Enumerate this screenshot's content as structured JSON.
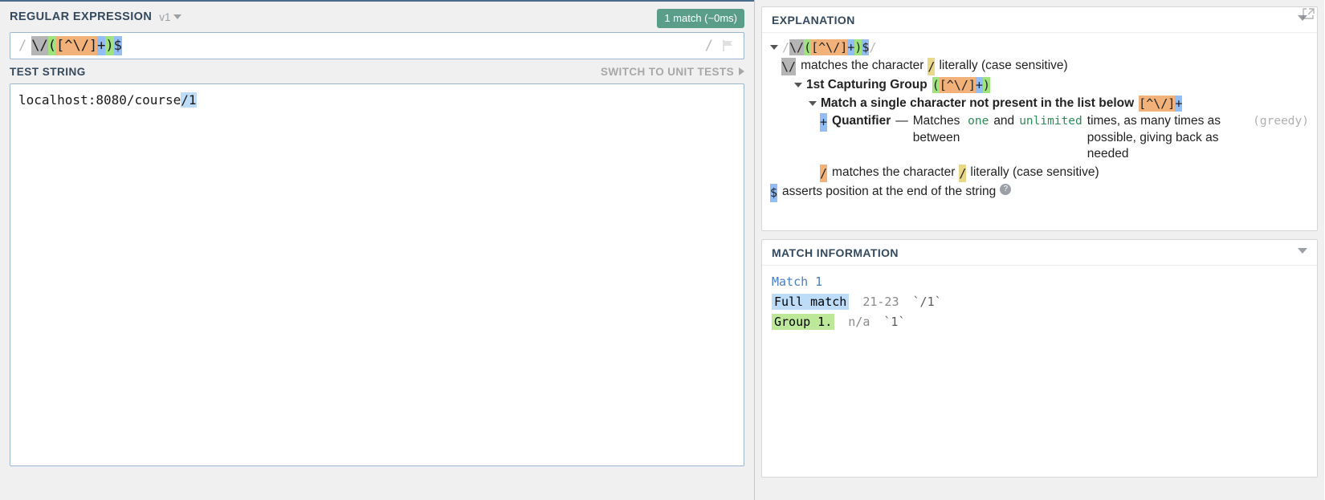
{
  "regex_section": {
    "title": "REGULAR EXPRESSION",
    "version": "v1",
    "match_badge": "1 match (~0ms)",
    "delimiter_left": "/",
    "delimiter_right": "/",
    "flags": "",
    "pattern_tokens": [
      {
        "text": "\\/",
        "hl": "gray"
      },
      {
        "text": "(",
        "hl": "green"
      },
      {
        "text": "[^\\/]",
        "hl": "orange"
      },
      {
        "text": "+",
        "hl": "blue"
      },
      {
        "text": ")",
        "hl": "green"
      },
      {
        "text": "$",
        "hl": "blue"
      }
    ],
    "pattern_full": "\\/([^\\/]+)$"
  },
  "test_section": {
    "title": "TEST STRING",
    "switch_label": "SWITCH TO UNIT TESTS",
    "text_before": "localhost:8080/course",
    "text_match": "/1",
    "text_after": "",
    "full_text": "localhost:8080/course/1"
  },
  "explanation": {
    "title": "EXPLANATION",
    "header_tokens": [
      {
        "text": "/",
        "hl": "none"
      },
      {
        "text": "\\/",
        "hl": "gray"
      },
      {
        "text": "(",
        "hl": "green"
      },
      {
        "text": "[^\\/]",
        "hl": "orange"
      },
      {
        "text": "+",
        "hl": "blue"
      },
      {
        "text": ")",
        "hl": "green"
      },
      {
        "text": "$",
        "hl": "blue"
      },
      {
        "text": "/",
        "hl": "none"
      }
    ],
    "rows": [
      {
        "token": "\\/",
        "hl": "gray",
        "text_a": "matches the character",
        "literal": "/",
        "literal_hl": "sand",
        "text_b": "literally (case sensitive)"
      },
      {
        "label": "1st Capturing Group",
        "group_tokens": [
          {
            "text": "(",
            "hl": "green"
          },
          {
            "text": "[^\\/]",
            "hl": "orange"
          },
          {
            "text": "+",
            "hl": "blue"
          },
          {
            "text": ")",
            "hl": "green"
          }
        ]
      },
      {
        "label": "Match a single character not present in the list below",
        "tail_tokens": [
          {
            "text": "[^\\/]",
            "hl": "orange"
          },
          {
            "text": "+",
            "hl": "blue"
          }
        ]
      },
      {
        "token": "+",
        "hl": "blue",
        "label": "Quantifier",
        "dash": "—",
        "text_a": "Matches between",
        "num_one": "one",
        "text_b": "and",
        "num_unlimited": "unlimited",
        "text_c": "times, as many times as possible, giving back as needed",
        "greedy": "(greedy)"
      },
      {
        "token": "/",
        "hl": "orange",
        "text_a": "matches the character",
        "literal": "/",
        "literal_hl": "sand",
        "text_b": "literally (case sensitive)"
      },
      {
        "token": "$",
        "hl": "blue",
        "text_a": "asserts position at the end of the string",
        "help": "?"
      }
    ]
  },
  "match_information": {
    "title": "MATCH INFORMATION",
    "match_label": "Match 1",
    "rows": [
      {
        "name": "Full match",
        "chip": "blue",
        "range": "21-23",
        "value": "`/1`"
      },
      {
        "name": "Group 1.",
        "chip": "green",
        "range": "n/a",
        "value": "`1`"
      }
    ]
  }
}
